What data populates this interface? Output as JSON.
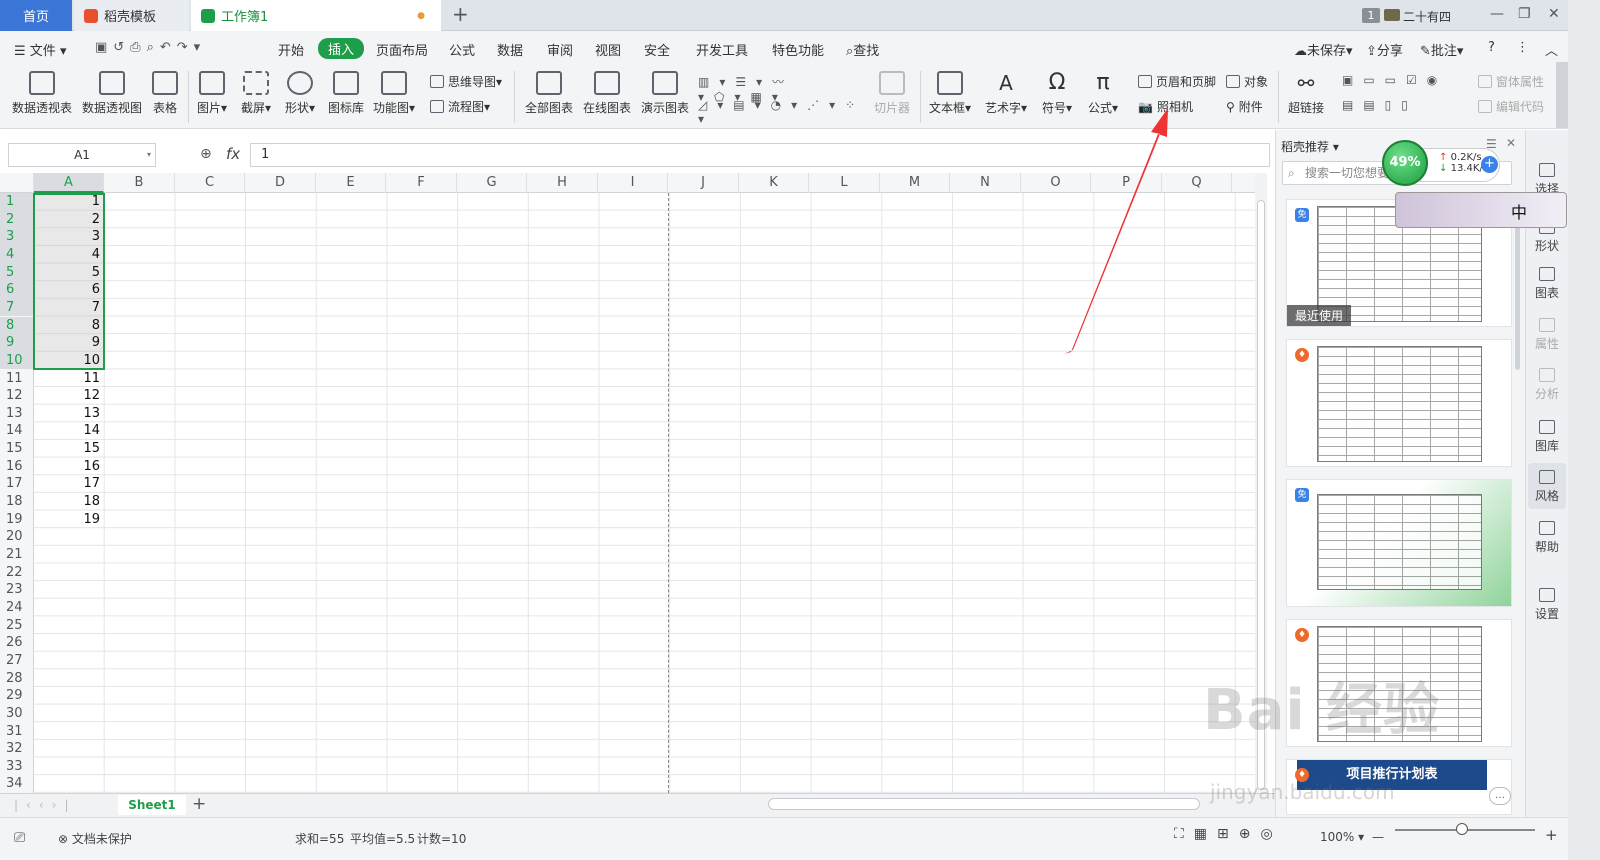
{
  "tabs": {
    "home": "首页",
    "template": "稻壳模板",
    "workbook": "工作簿1",
    "modified_dot": "●",
    "add": "+"
  },
  "topright": {
    "badge": "1",
    "user": "二十有四",
    "min": "—",
    "max": "❐",
    "close": "✕"
  },
  "menu": [
    "文件",
    "开始",
    "插入",
    "页面布局",
    "公式",
    "数据",
    "审阅",
    "视图",
    "安全",
    "开发工具",
    "特色功能",
    "查找"
  ],
  "menu_active": "插入",
  "menu_right": {
    "unsaved": "未保存",
    "share": "分享",
    "comment": "批注",
    "help": "?",
    "more": "⋮",
    "collapse": "︿"
  },
  "ribbon": {
    "big": [
      "数据透视表",
      "数据透视图",
      "表格",
      "图片",
      "截屏",
      "形状",
      "图标库",
      "功能图",
      "全部图表",
      "在线图表",
      "演示图表",
      "切片器",
      "文本框",
      "艺术字",
      "符号",
      "公式",
      "超链接"
    ],
    "small": {
      "mindmap": "思维导图",
      "flowchart": "流程图",
      "header_footer": "页眉和页脚",
      "object": "对象",
      "camera": "照相机",
      "attach": "附件",
      "window_attr": "窗体属性",
      "edit_code": "编辑代码"
    }
  },
  "formula": {
    "cell_ref": "A1",
    "fx": "fx",
    "value": "1"
  },
  "columns": [
    "A",
    "B",
    "C",
    "D",
    "E",
    "F",
    "G",
    "H",
    "I",
    "J",
    "K",
    "L",
    "M",
    "N",
    "O",
    "P",
    "Q"
  ],
  "rows": [
    1,
    2,
    3,
    4,
    5,
    6,
    7,
    8,
    9,
    10,
    11,
    12,
    13,
    14,
    15,
    16,
    17,
    18,
    19,
    20,
    21,
    22,
    23,
    24,
    25,
    26,
    27,
    28,
    29,
    30,
    31,
    32,
    33,
    34
  ],
  "column_a_values": [
    1,
    2,
    3,
    4,
    5,
    6,
    7,
    8,
    9,
    10,
    11,
    12,
    13,
    14,
    15,
    16,
    17,
    18,
    19
  ],
  "sheets": {
    "active": "Sheet1",
    "add": "+"
  },
  "status": {
    "protect": "文档未保护",
    "sum": "求和=55",
    "avg": "平均值=5.5",
    "count": "计数=10",
    "zoom": "100%",
    "minus": "—",
    "plus": "+"
  },
  "panel": {
    "title": "稻壳推荐",
    "search_placeholder": "搜索一切您想要",
    "recent": "最近使用",
    "free_badge": "免",
    "card5_title": "项目推行计划表"
  },
  "right_tools": [
    "选择",
    "形状",
    "图表",
    "属性",
    "分析",
    "图库",
    "风格",
    "帮助",
    "设置"
  ],
  "net": {
    "percent": "49%",
    "up": "0.2K/s",
    "down": "13.4K/s"
  },
  "ime": {
    "char": "中"
  },
  "watermark": {
    "main": "Bai 经验",
    "sub": "jingyan.baidu.com"
  },
  "colors": {
    "accent": "#1e9e4a",
    "home_tab": "#3b76d6",
    "selection": "#1e9e4a",
    "arrow": "#ee3333"
  }
}
